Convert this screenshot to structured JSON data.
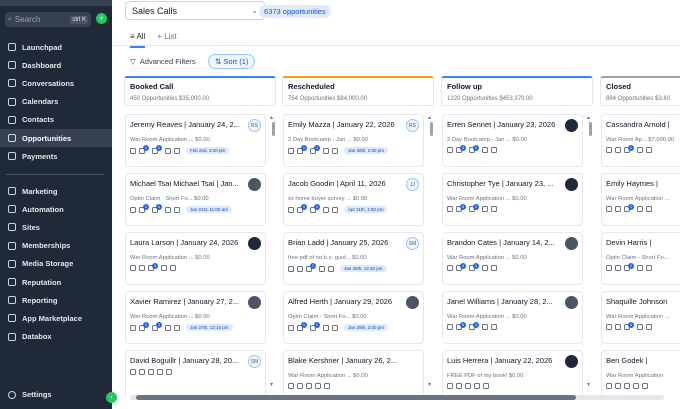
{
  "sidebar": {
    "search_placeholder": "Search",
    "shortcut": "ctrl K",
    "plus": "+",
    "items": [
      {
        "label": "Launchpad",
        "icon": "rocket-icon"
      },
      {
        "label": "Dashboard",
        "icon": "dashboard-icon"
      },
      {
        "label": "Conversations",
        "icon": "chat-icon"
      },
      {
        "label": "Calendars",
        "icon": "calendar-icon"
      },
      {
        "label": "Contacts",
        "icon": "contacts-icon"
      },
      {
        "label": "Opportunities",
        "icon": "opportunities-icon",
        "active": true
      },
      {
        "label": "Payments",
        "icon": "payments-icon"
      }
    ],
    "items2": [
      {
        "label": "Marketing",
        "icon": "send-icon"
      },
      {
        "label": "Automation",
        "icon": "automation-icon"
      },
      {
        "label": "Sites",
        "icon": "globe-icon"
      },
      {
        "label": "Memberships",
        "icon": "memberships-icon"
      },
      {
        "label": "Media Storage",
        "icon": "media-icon"
      },
      {
        "label": "Reputation",
        "icon": "star-icon"
      },
      {
        "label": "Reporting",
        "icon": "chart-icon"
      },
      {
        "label": "App Marketplace",
        "icon": "apps-icon"
      },
      {
        "label": "Databox",
        "icon": "databox-icon"
      }
    ],
    "settings": "Settings",
    "collapse": "‹"
  },
  "header": {
    "pipeline": "Sales Calls",
    "opp_count": "6373 opportunities",
    "tab_all": "All",
    "tab_list": "List",
    "filters": "Advanced Filters",
    "sort": "Sort (1)"
  },
  "columns": [
    {
      "name": "Booked Call",
      "summary": "450 Opportunities  $35,000.00",
      "color": "#3b82f6",
      "cards": [
        {
          "title": "Jeremy Reaves | January 24, 2...",
          "sub": "War Room Application ...   $0.00",
          "avatar": "RS",
          "avatar_type": "in",
          "date": "Feb 2nd, 3:30 pm",
          "b1": "1",
          "b2": "1"
        },
        {
          "title": "Michael Tsai Michael Tsai | Jan...",
          "sub": "Optin Claim - Short Fo...   $0.00",
          "avatar": "",
          "avatar_type": "ph",
          "date": "Jan 21st, 11:00 am",
          "b1": "1",
          "b2": "1"
        },
        {
          "title": "Laura Larson | January 24, 2026",
          "sub": "War Room Application ...   $0.00",
          "avatar": "",
          "avatar_type": "dk",
          "date": "",
          "b1": "",
          "b2": "1"
        },
        {
          "title": "Xavier Ramirez | January 27, 2...",
          "sub": "War Room Application ...   $0.00",
          "avatar": "",
          "avatar_type": "ph",
          "date": "Jan 27th, 12:15 pm",
          "b1": "1",
          "b2": "1"
        },
        {
          "title": "David Boguillr | January 28, 20...",
          "sub": "",
          "avatar": "SM",
          "avatar_type": "in",
          "date": "",
          "b1": "",
          "b2": ""
        }
      ]
    },
    {
      "name": "Rescheduled",
      "summary": "754 Opportunities  $84,000.00",
      "color": "#f59e0b",
      "cards": [
        {
          "title": "Emily Mazza | January 22, 2026",
          "sub": "2 Day Bootcamp - Jan ...   $0.00",
          "avatar": "RS",
          "avatar_type": "in",
          "date": "Jan 28th, 2:00 pm",
          "b1": "1",
          "b2": "1"
        },
        {
          "title": "Jacob Goodin | April 11, 2026",
          "sub": "xx home buyer survey ...   $0.00",
          "avatar": "JJ",
          "avatar_type": "in",
          "date": "Apr 11th, 1:00 pm",
          "b1": "1",
          "b2": "1"
        },
        {
          "title": "Brian Ladd | January 25, 2026",
          "sub": "free pdf of no b.s. guid...   $0.00",
          "avatar": "SM",
          "avatar_type": "in",
          "date": "Jan 25th, 12:30 pm",
          "b1": "",
          "b2": "1"
        },
        {
          "title": "Alfred Herth | January 29, 2026",
          "sub": "Optin Claim - Short Fo...   $0.00",
          "avatar": "",
          "avatar_type": "ph",
          "date": "Jan 29th, 3:00 pm",
          "b1": "1",
          "b2": "1"
        },
        {
          "title": "Blake Kershner | January 26, 2...",
          "sub": "War Room Application ...   $0.00",
          "avatar": "",
          "avatar_type": "",
          "date": "",
          "b1": "",
          "b2": ""
        }
      ]
    },
    {
      "name": "Follow up",
      "summary": "1220 Opportunities  $453,370.00",
      "color": "#3b82f6",
      "cards": [
        {
          "title": "Erren Sennet | January 23, 2026",
          "sub": "2 Day Bootcamp - Jan ...   $0.00",
          "avatar": "",
          "avatar_type": "dk",
          "date": "",
          "b1": "4",
          "b2": "1"
        },
        {
          "title": "Christopher Tye | January 23, ...",
          "sub": "War Room Application ...   $0.00",
          "avatar": "",
          "avatar_type": "dk",
          "date": "",
          "b1": "8",
          "b2": "1"
        },
        {
          "title": "Brandon Cates | January 14, 2...",
          "sub": "War Room Application ...   $0.00",
          "avatar": "",
          "avatar_type": "ph",
          "date": "",
          "b1": "4",
          "b2": "1"
        },
        {
          "title": "Janel Williams | January 28, 2...",
          "sub": "War Room Application ...   $0.00",
          "avatar": "",
          "avatar_type": "ph",
          "date": "",
          "b1": "5",
          "b2": "1"
        },
        {
          "title": "Luis Herrera | January 22, 2026",
          "sub": "FREE PDF of my book!   $0.00",
          "avatar": "",
          "avatar_type": "dk",
          "date": "",
          "b1": "",
          "b2": ""
        }
      ]
    },
    {
      "name": "Closed",
      "summary": "884 Opportunities  $3,60",
      "color": "#9ca3af",
      "cards": [
        {
          "title": "Cassandra Arnold |",
          "sub": "War Room Ap...   $7,000.00",
          "avatar": "",
          "avatar_type": "",
          "date": "",
          "b1": "",
          "b2": "1"
        },
        {
          "title": "Emily Haymes |",
          "sub": "War Room Application ...",
          "avatar": "",
          "avatar_type": "",
          "date": "",
          "b1": "",
          "b2": "1"
        },
        {
          "title": "Devin Harris |",
          "sub": "Optin Claim - Short Fo...",
          "avatar": "",
          "avatar_type": "",
          "date": "",
          "b1": "",
          "b2": "1"
        },
        {
          "title": "Shaquille Johnson",
          "sub": "War Room Application ...",
          "avatar": "",
          "avatar_type": "",
          "date": "",
          "b1": "",
          "b2": "4"
        },
        {
          "title": "Ben Godek |",
          "sub": "War Room Application",
          "avatar": "",
          "avatar_type": "",
          "date": "",
          "b1": "",
          "b2": ""
        }
      ]
    }
  ]
}
